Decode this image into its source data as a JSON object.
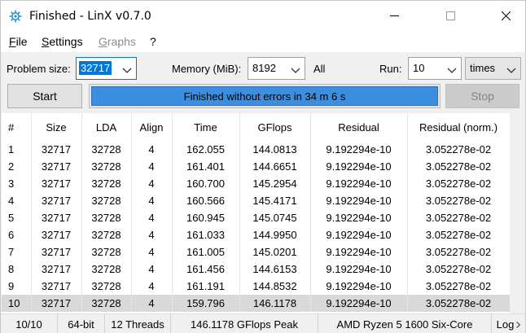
{
  "window": {
    "title": "Finished - LinX v0.7.0"
  },
  "menu": {
    "file": "File",
    "settings": "Settings",
    "graphs": "Graphs",
    "help": "?"
  },
  "controls": {
    "problem_size_label": "Problem size:",
    "problem_size_value": "32717",
    "memory_label": "Memory (MiB):",
    "memory_value": "8192",
    "all_label": "All",
    "run_label": "Run:",
    "run_value": "10",
    "run_unit": "times"
  },
  "actions": {
    "start_label": "Start",
    "stop_label": "Stop",
    "progress_text": "Finished without errors in 34 m 6 s",
    "progress_fraction": 1.0
  },
  "table": {
    "columns": [
      "#",
      "Size",
      "LDA",
      "Align",
      "Time",
      "GFlops",
      "Residual",
      "Residual (norm.)"
    ],
    "rows": [
      [
        "1",
        "32717",
        "32728",
        "4",
        "162.055",
        "144.0813",
        "9.192294e-10",
        "3.052278e-02"
      ],
      [
        "2",
        "32717",
        "32728",
        "4",
        "161.401",
        "144.6651",
        "9.192294e-10",
        "3.052278e-02"
      ],
      [
        "3",
        "32717",
        "32728",
        "4",
        "160.700",
        "145.2954",
        "9.192294e-10",
        "3.052278e-02"
      ],
      [
        "4",
        "32717",
        "32728",
        "4",
        "160.566",
        "145.4171",
        "9.192294e-10",
        "3.052278e-02"
      ],
      [
        "5",
        "32717",
        "32728",
        "4",
        "160.945",
        "145.0745",
        "9.192294e-10",
        "3.052278e-02"
      ],
      [
        "6",
        "32717",
        "32728",
        "4",
        "161.033",
        "144.9950",
        "9.192294e-10",
        "3.052278e-02"
      ],
      [
        "7",
        "32717",
        "32728",
        "4",
        "161.005",
        "145.0201",
        "9.192294e-10",
        "3.052278e-02"
      ],
      [
        "8",
        "32717",
        "32728",
        "4",
        "161.456",
        "144.6153",
        "9.192294e-10",
        "3.052278e-02"
      ],
      [
        "9",
        "32717",
        "32728",
        "4",
        "161.191",
        "144.8532",
        "9.192294e-10",
        "3.052278e-02"
      ],
      [
        "10",
        "32717",
        "32728",
        "4",
        "159.796",
        "146.1178",
        "9.192294e-10",
        "3.052278e-02"
      ]
    ],
    "selected_row": 10
  },
  "status": {
    "runs": "10/10",
    "arch": "64-bit",
    "threads": "12 Threads",
    "peak": "146.1178 GFlops Peak",
    "cpu": "AMD Ryzen 5 1600 Six-Core",
    "log": "Log"
  },
  "colors": {
    "accent": "#0078d7",
    "progress_fill": "#3c8fe0",
    "selected_row": "#d9d9d9"
  },
  "icons": {
    "app": "gear-icon",
    "minimize": "minimize-icon",
    "maximize": "maximize-icon",
    "close": "close-icon",
    "dropdown": "chevron-down-icon",
    "log": "chevron-right-icon"
  }
}
